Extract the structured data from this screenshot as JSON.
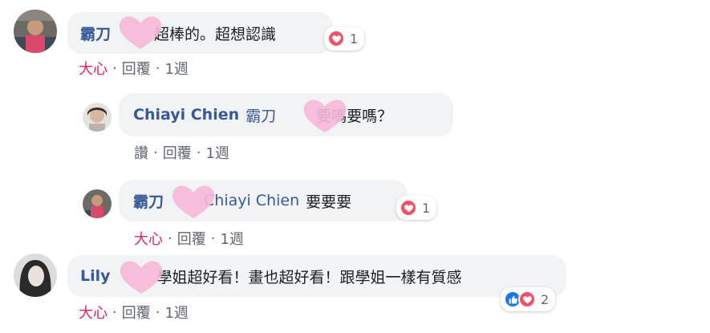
{
  "comments": [
    {
      "author_visible": "霸刀",
      "author_tail": "",
      "text": "超棒的。超想認識",
      "reaction_count": "1",
      "actions": {
        "reaction": "大心",
        "reply": "回覆",
        "time": "1週"
      }
    },
    {
      "author": "Chiayi Chien",
      "mention_visible": "霸刀",
      "text": "要嗎要嗎？",
      "actions": {
        "reaction": "讚",
        "reply": "回覆",
        "time": "1週"
      }
    },
    {
      "author_visible": "霸刀",
      "mention": "Chiayi Chien",
      "text": "要要要",
      "reaction_count": "1",
      "actions": {
        "reaction": "大心",
        "reply": "回覆",
        "time": "1週"
      }
    },
    {
      "author_visible": "Lily",
      "text": "學姐超好看！畫也超好看！跟學姐一樣有質感",
      "reaction_count": "2",
      "actions": {
        "reaction": "大心",
        "reply": "回覆",
        "time": "1週"
      }
    }
  ],
  "colors": {
    "bubble_bg": "#f2f3f5",
    "name": "#385898",
    "love": "#e0245e",
    "meta": "#606770",
    "heart_icon": "#f25268",
    "like_icon": "#1877f2",
    "privacy_heart": "#f6b8d8"
  },
  "icons": [
    "heart-reaction-icon",
    "like-reaction-icon",
    "privacy-heart-mask"
  ]
}
